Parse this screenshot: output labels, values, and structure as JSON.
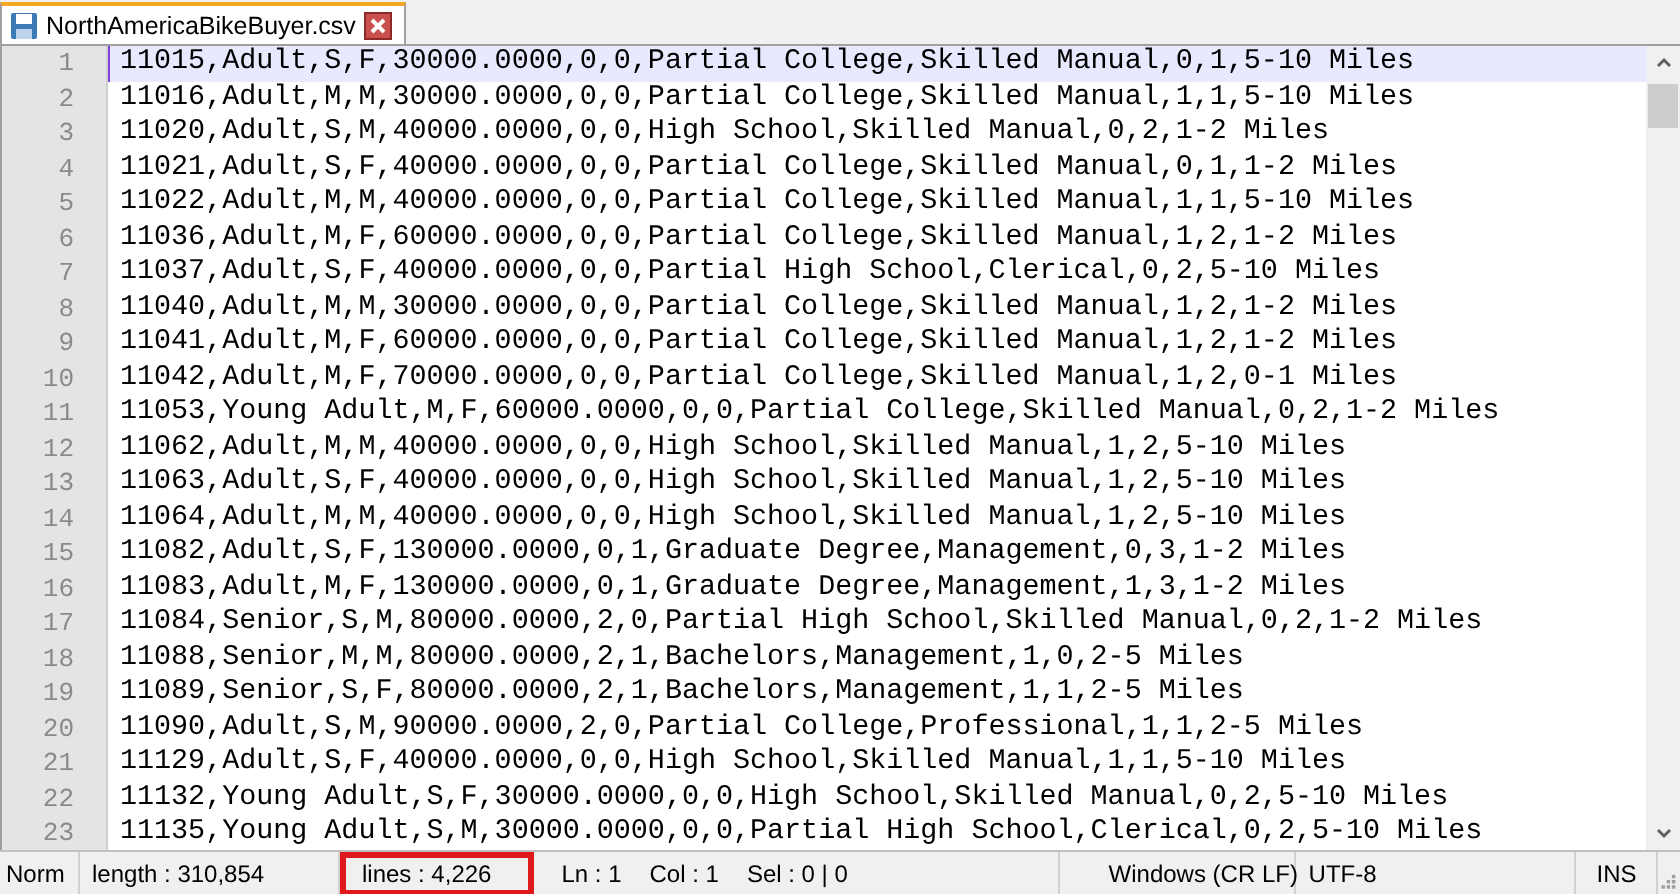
{
  "tab": {
    "title": "NorthAmericaBikeBuyer.csv",
    "selected": true
  },
  "lines": [
    {
      "number": "1",
      "text": "11015,Adult,S,F,30000.0000,0,0,Partial College,Skilled Manual,0,1,5-10 Miles",
      "current": true
    },
    {
      "number": "2",
      "text": "11016,Adult,M,M,30000.0000,0,0,Partial College,Skilled Manual,1,1,5-10 Miles",
      "current": false
    },
    {
      "number": "3",
      "text": "11020,Adult,S,M,40000.0000,0,0,High School,Skilled Manual,0,2,1-2 Miles",
      "current": false
    },
    {
      "number": "4",
      "text": "11021,Adult,S,F,40000.0000,0,0,Partial College,Skilled Manual,0,1,1-2 Miles",
      "current": false
    },
    {
      "number": "5",
      "text": "11022,Adult,M,M,40000.0000,0,0,Partial College,Skilled Manual,1,1,5-10 Miles",
      "current": false
    },
    {
      "number": "6",
      "text": "11036,Adult,M,F,60000.0000,0,0,Partial College,Skilled Manual,1,2,1-2 Miles",
      "current": false
    },
    {
      "number": "7",
      "text": "11037,Adult,S,F,40000.0000,0,0,Partial High School,Clerical,0,2,5-10 Miles",
      "current": false
    },
    {
      "number": "8",
      "text": "11040,Adult,M,M,30000.0000,0,0,Partial College,Skilled Manual,1,2,1-2 Miles",
      "current": false
    },
    {
      "number": "9",
      "text": "11041,Adult,M,F,60000.0000,0,0,Partial College,Skilled Manual,1,2,1-2 Miles",
      "current": false
    },
    {
      "number": "10",
      "text": "11042,Adult,M,F,70000.0000,0,0,Partial College,Skilled Manual,1,2,0-1 Miles",
      "current": false
    },
    {
      "number": "11",
      "text": "11053,Young Adult,M,F,60000.0000,0,0,Partial College,Skilled Manual,0,2,1-2 Miles",
      "current": false
    },
    {
      "number": "12",
      "text": "11062,Adult,M,M,40000.0000,0,0,High School,Skilled Manual,1,2,5-10 Miles",
      "current": false
    },
    {
      "number": "13",
      "text": "11063,Adult,S,F,40000.0000,0,0,High School,Skilled Manual,1,2,5-10 Miles",
      "current": false
    },
    {
      "number": "14",
      "text": "11064,Adult,M,M,40000.0000,0,0,High School,Skilled Manual,1,2,5-10 Miles",
      "current": false
    },
    {
      "number": "15",
      "text": "11082,Adult,S,F,130000.0000,0,1,Graduate Degree,Management,0,3,1-2 Miles",
      "current": false
    },
    {
      "number": "16",
      "text": "11083,Adult,M,F,130000.0000,0,1,Graduate Degree,Management,1,3,1-2 Miles",
      "current": false
    },
    {
      "number": "17",
      "text": "11084,Senior,S,M,80000.0000,2,0,Partial High School,Skilled Manual,0,2,1-2 Miles",
      "current": false
    },
    {
      "number": "18",
      "text": "11088,Senior,M,M,80000.0000,2,1,Bachelors,Management,1,0,2-5 Miles",
      "current": false
    },
    {
      "number": "19",
      "text": "11089,Senior,S,F,80000.0000,2,1,Bachelors,Management,1,1,2-5 Miles",
      "current": false
    },
    {
      "number": "20",
      "text": "11090,Adult,S,M,90000.0000,2,0,Partial College,Professional,1,1,2-5 Miles",
      "current": false
    },
    {
      "number": "21",
      "text": "11129,Adult,S,F,40000.0000,0,0,High School,Skilled Manual,1,1,5-10 Miles",
      "current": false
    },
    {
      "number": "22",
      "text": "11132,Young Adult,S,F,30000.0000,0,0,High School,Skilled Manual,0,2,5-10 Miles",
      "current": false
    },
    {
      "number": "23",
      "text": "11135,Young Adult,S,M,30000.0000,0,0,Partial High School,Clerical,0,2,5-10 Miles",
      "current": false
    }
  ],
  "status_bar": [
    {
      "text": "Norm"
    },
    {
      "text": "length : 310,854"
    },
    {
      "text": "lines : 4,226",
      "highlighted": true
    },
    {
      "text": "Ln : 1"
    },
    {
      "text": "Col : 1"
    },
    {
      "text": "Sel : 0 | 0"
    },
    {
      "text": "Windows (CR LF)"
    },
    {
      "text": "UTF-8"
    },
    {
      "text": "INS"
    }
  ]
}
